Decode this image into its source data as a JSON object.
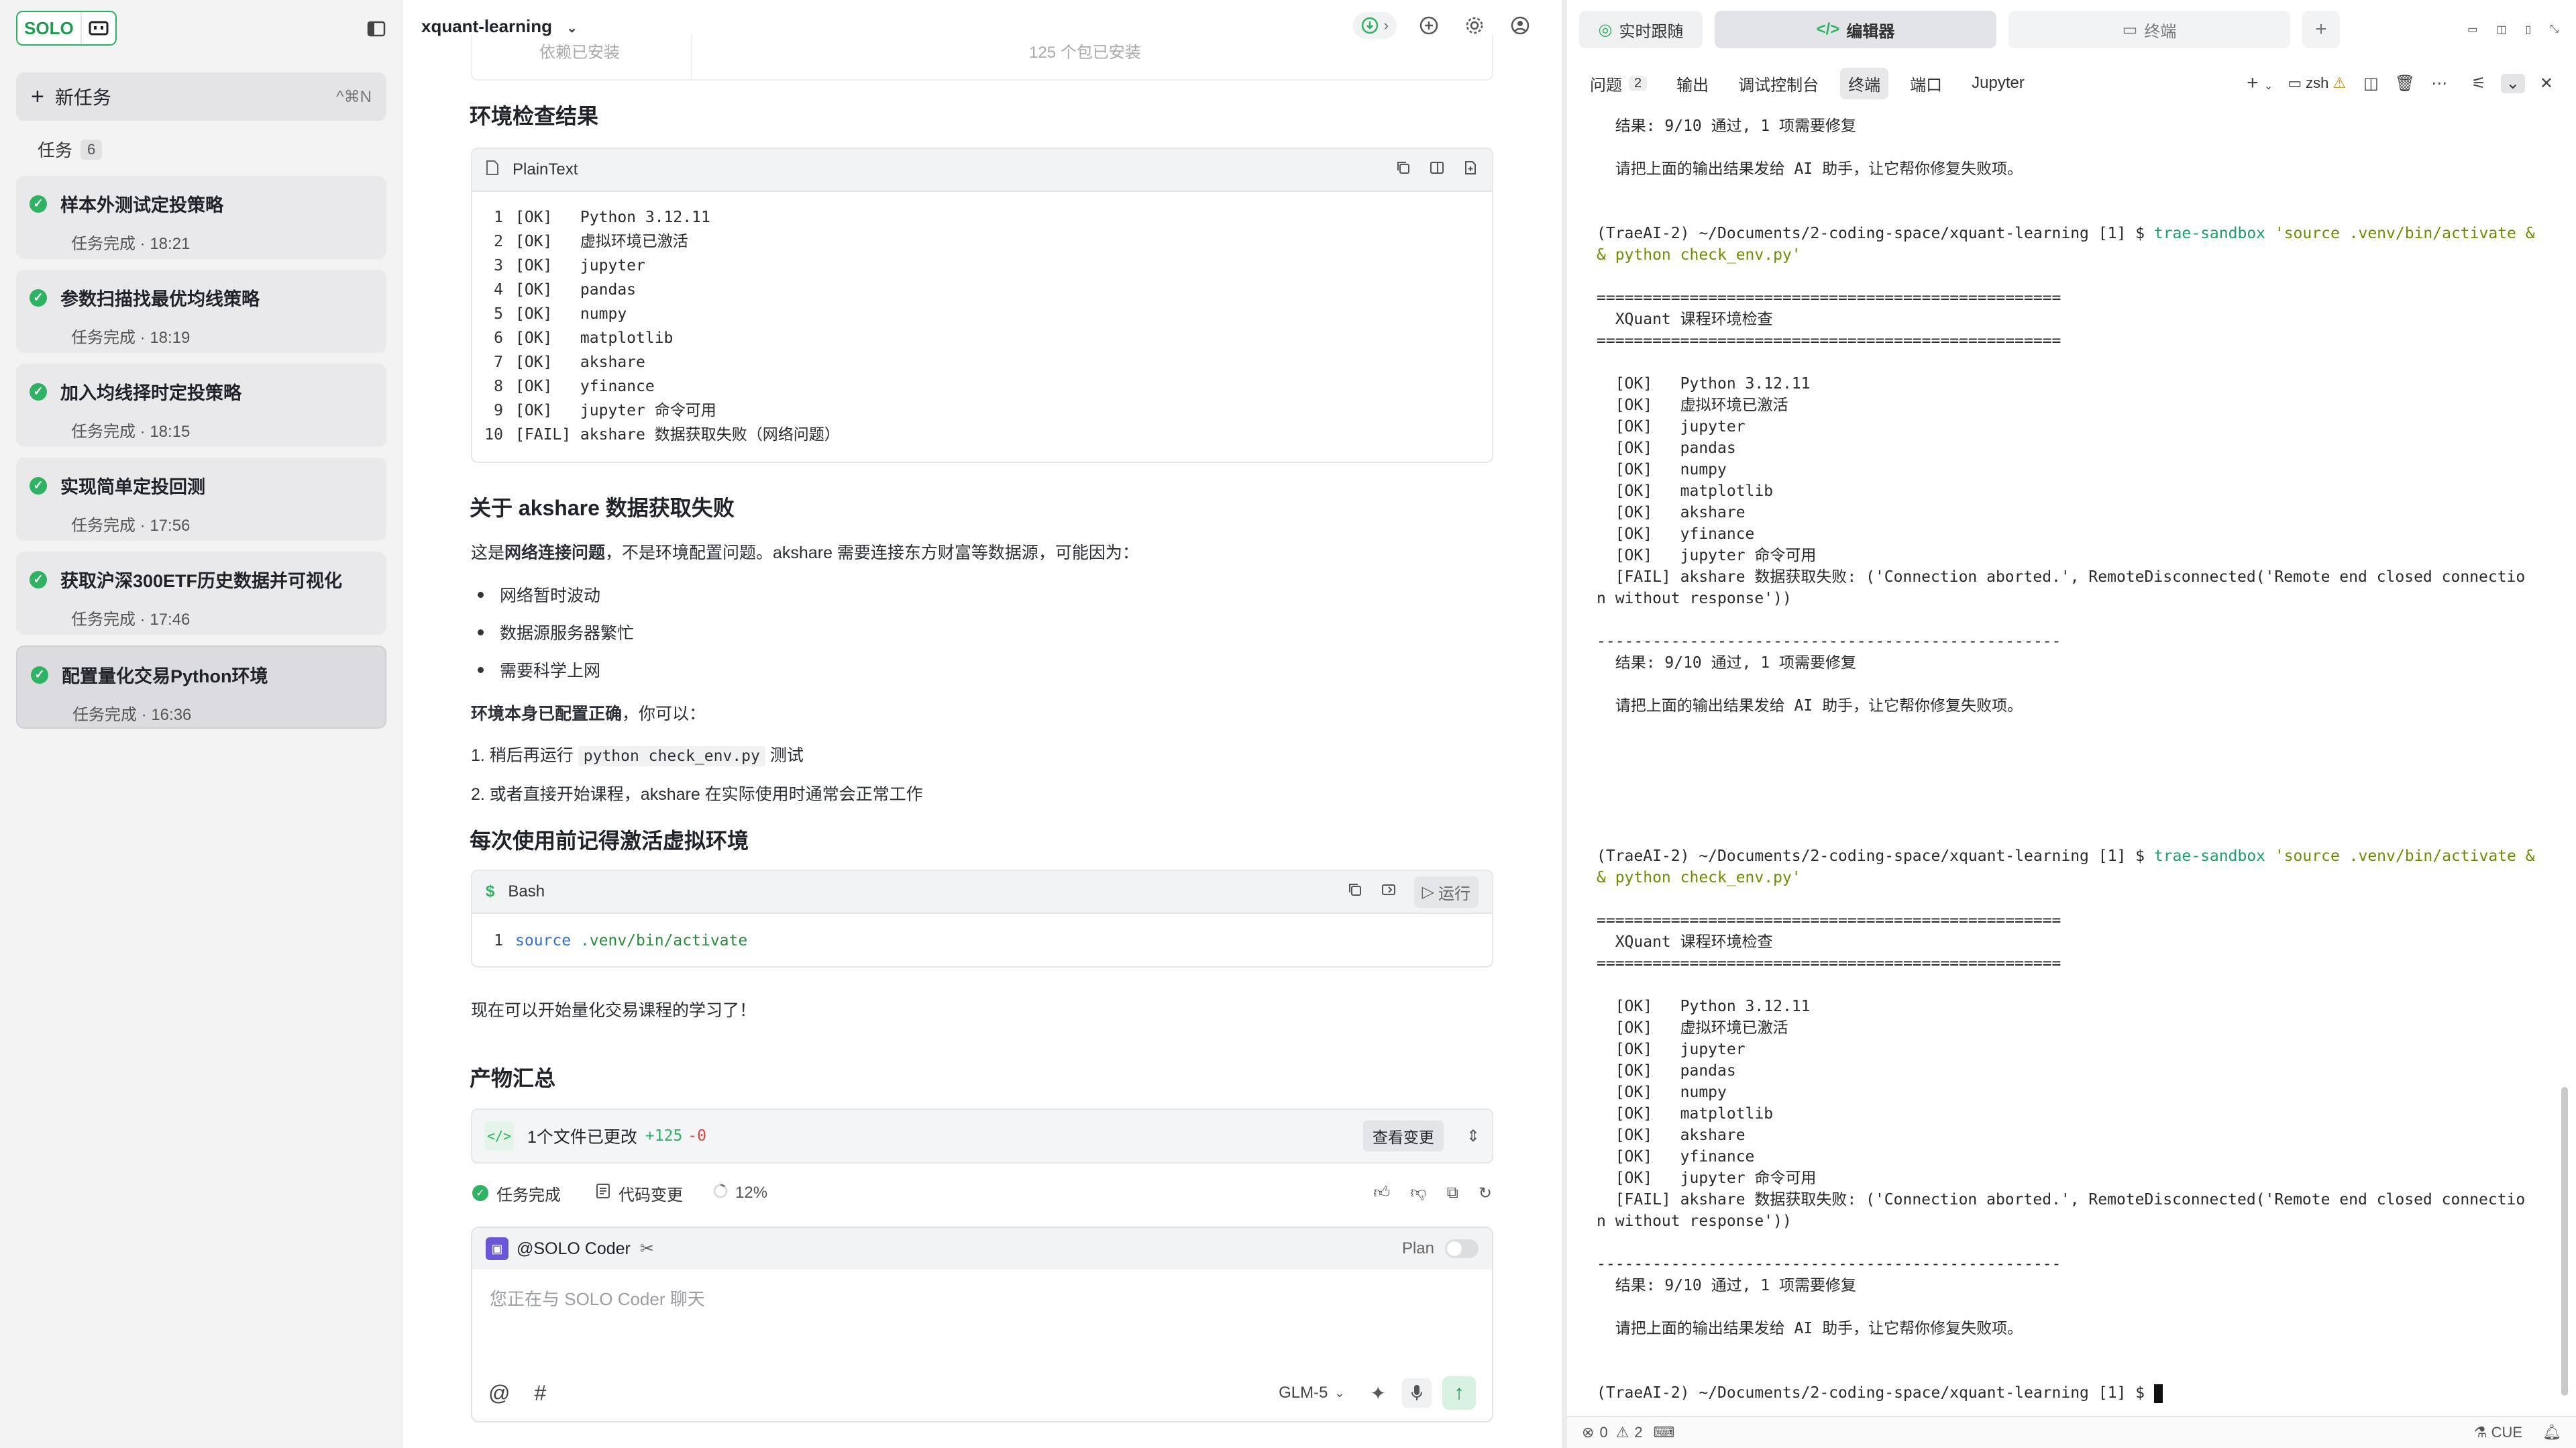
{
  "sidebar": {
    "logo_text": "SOLO",
    "new_task_label": "新任务",
    "new_task_shortcut": "^⌘N",
    "tasks_label": "任务",
    "tasks_count": "6",
    "tasks": [
      {
        "title": "样本外测试定投策略",
        "meta": "任务完成 · 18:21"
      },
      {
        "title": "参数扫描找最优均线策略",
        "meta": "任务完成 · 18:19"
      },
      {
        "title": "加入均线择时定投策略",
        "meta": "任务完成 · 18:15"
      },
      {
        "title": "实现简单定投回测",
        "meta": "任务完成 · 17:56"
      },
      {
        "title": "获取沪深300ETF历史数据并可视化",
        "meta": "任务完成 · 17:46"
      },
      {
        "title": "配置量化交易Python环境",
        "meta": "任务完成 · 16:36"
      }
    ]
  },
  "chat": {
    "project": "xquant-learning",
    "top_fade_left": "依赖已安装",
    "top_fade_right": "125 个包已安装",
    "env_heading": "环境检查结果",
    "code1": {
      "lang": "PlainText",
      "lines": [
        "[OK]   Python 3.12.11",
        "[OK]   虚拟环境已激活",
        "[OK]   jupyter",
        "[OK]   pandas",
        "[OK]   numpy",
        "[OK]   matplotlib",
        "[OK]   akshare",
        "[OK]   yfinance",
        "[OK]   jupyter 命令可用",
        "[FAIL] akshare 数据获取失败（网络问题）"
      ]
    },
    "akshare_heading": "关于 akshare 数据获取失败",
    "akshare_para_pre": "这是",
    "akshare_para_bold": "网络连接问题",
    "akshare_para_post": "，不是环境配置问题。akshare 需要连接东方财富等数据源，可能因为：",
    "bullets": [
      "网络暂时波动",
      "数据源服务器繁忙",
      "需要科学上网"
    ],
    "env_ok_bold": "环境本身已配置正确",
    "env_ok_rest": "，你可以：",
    "step1_pre": "1. 稍后再运行",
    "step1_code": "python check_env.py",
    "step1_post": "测试",
    "step2": "2. 或者直接开始课程，akshare 在实际使用时通常会正常工作",
    "activate_heading": "每次使用前记得激活虚拟环境",
    "code2": {
      "lang": "Bash",
      "run_label": "运行",
      "keyword": "source",
      "arg": ".venv/bin/activate"
    },
    "ready_text": "现在可以开始量化交易课程的学习了！",
    "artifacts_heading": "产物汇总",
    "changes": {
      "files": "1个文件已更改",
      "plus": "+125",
      "minus": "-0",
      "view_label": "查看变更"
    },
    "status": {
      "done": "任务完成",
      "code_changes": "代码变更",
      "percent": "12%"
    },
    "input": {
      "agent": "@SOLO Coder",
      "plan_label": "Plan",
      "placeholder": "您正在与 SOLO Coder 聊天",
      "model": "GLM-5"
    }
  },
  "terminal": {
    "tabs": [
      "实时跟随",
      "编辑器",
      "终端"
    ],
    "panel_tabs": [
      "问题",
      "输出",
      "调试控制台",
      "终端",
      "端口",
      "Jupyter"
    ],
    "problems_count": "2",
    "shell": "zsh",
    "lines": [
      {
        "t": "  结果: 9/10 通过, 1 项需要修复"
      },
      {
        "t": ""
      },
      {
        "t": "  请把上面的输出结果发给 AI 助手，让它帮你修复失败项。"
      },
      {
        "t": ""
      },
      {
        "t": ""
      },
      {
        "t": "(TraeAI-2) ~/Documents/2-coding-space/xquant-learning [1] $ ",
        "cmd": "trae-sandbox",
        "arg": " 'source .venv/bin/activate &"
      },
      {
        "t": "",
        "arg": "& python check_env.py'"
      },
      {
        "t": ""
      },
      {
        "t": "=================================================="
      },
      {
        "t": "  XQuant 课程环境检查"
      },
      {
        "t": "=================================================="
      },
      {
        "t": ""
      },
      {
        "t": "  [OK]   Python 3.12.11"
      },
      {
        "t": "  [OK]   虚拟环境已激活"
      },
      {
        "t": "  [OK]   jupyter"
      },
      {
        "t": "  [OK]   pandas"
      },
      {
        "t": "  [OK]   numpy"
      },
      {
        "t": "  [OK]   matplotlib"
      },
      {
        "t": "  [OK]   akshare"
      },
      {
        "t": "  [OK]   yfinance"
      },
      {
        "t": "  [OK]   jupyter 命令可用"
      },
      {
        "t": "  [FAIL] akshare 数据获取失败: ('Connection aborted.', RemoteDisconnected('Remote end closed connectio"
      },
      {
        "t": "n without response'))"
      },
      {
        "t": ""
      },
      {
        "t": "--------------------------------------------------"
      },
      {
        "t": "  结果: 9/10 通过, 1 项需要修复"
      },
      {
        "t": ""
      },
      {
        "t": "  请把上面的输出结果发给 AI 助手，让它帮你修复失败项。"
      },
      {
        "t": ""
      },
      {
        "t": ""
      },
      {
        "t": ""
      },
      {
        "t": ""
      },
      {
        "t": ""
      },
      {
        "t": ""
      },
      {
        "t": "(TraeAI-2) ~/Documents/2-coding-space/xquant-learning [1] $ ",
        "cmd": "trae-sandbox",
        "arg": " 'source .venv/bin/activate &"
      },
      {
        "t": "",
        "arg": "& python check_env.py'"
      },
      {
        "t": ""
      },
      {
        "t": "=================================================="
      },
      {
        "t": "  XQuant 课程环境检查"
      },
      {
        "t": "=================================================="
      },
      {
        "t": ""
      },
      {
        "t": "  [OK]   Python 3.12.11"
      },
      {
        "t": "  [OK]   虚拟环境已激活"
      },
      {
        "t": "  [OK]   jupyter"
      },
      {
        "t": "  [OK]   pandas"
      },
      {
        "t": "  [OK]   numpy"
      },
      {
        "t": "  [OK]   matplotlib"
      },
      {
        "t": "  [OK]   akshare"
      },
      {
        "t": "  [OK]   yfinance"
      },
      {
        "t": "  [OK]   jupyter 命令可用"
      },
      {
        "t": "  [FAIL] akshare 数据获取失败: ('Connection aborted.', RemoteDisconnected('Remote end closed connectio"
      },
      {
        "t": "n without response'))"
      },
      {
        "t": ""
      },
      {
        "t": "--------------------------------------------------"
      },
      {
        "t": "  结果: 9/10 通过, 1 项需要修复"
      },
      {
        "t": ""
      },
      {
        "t": "  请把上面的输出结果发给 AI 助手，让它帮你修复失败项。"
      },
      {
        "t": ""
      },
      {
        "t": ""
      },
      {
        "t": "(TraeAI-2) ~/Documents/2-coding-space/xquant-learning [1] $ ",
        "cursor": true
      }
    ],
    "status": {
      "errors": "0",
      "warnings": "2",
      "cue": "CUE"
    }
  },
  "colors": {
    "accent": "#2fb263",
    "sidebar_bg": "#f3f3f4",
    "code_bg": "#f2f3f5"
  }
}
